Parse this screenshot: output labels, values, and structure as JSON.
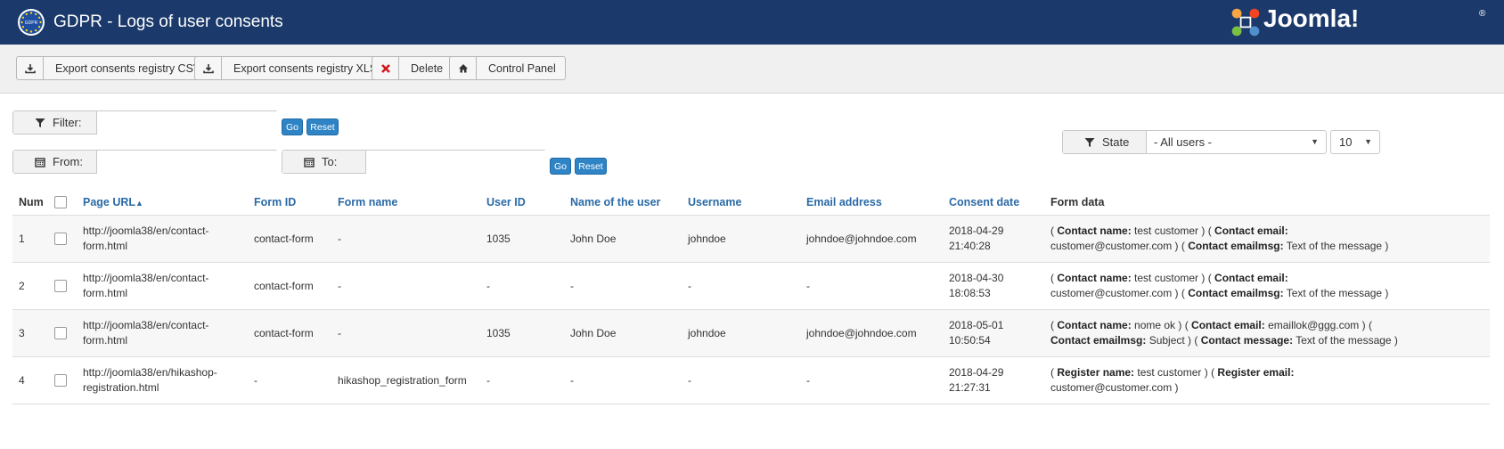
{
  "header": {
    "title": "GDPR - Logs of user consents",
    "badge_text": "GDPR",
    "brand": "Joomla!",
    "brand_mark": "®"
  },
  "toolbar": {
    "buttons": [
      {
        "label": "Export consents registry CSV",
        "icon": "download-icon"
      },
      {
        "label": "Export consents registry XLS",
        "icon": "download-icon"
      },
      {
        "label": "Delete",
        "icon": "close-icon"
      },
      {
        "label": "Control Panel",
        "icon": "home-icon"
      }
    ]
  },
  "filters": {
    "filter_label": "Filter:",
    "filter_value": "",
    "from_label": "From:",
    "to_label": "To:",
    "go_label": "Go",
    "reset_label": "Reset",
    "state_label": "State",
    "state_selected": "- All users -",
    "limit_selected": "10"
  },
  "table": {
    "headers": [
      "Num",
      "Page URL",
      "Form ID",
      "Form name",
      "User ID",
      "Name of the user",
      "Username",
      "Email address",
      "Consent date",
      "Form data"
    ],
    "sort_indicator": "▲",
    "rows": [
      {
        "num": "1",
        "url": [
          "http://joomla38/en/contact-",
          "form.html"
        ],
        "form_id": "contact-form",
        "form_name": "-",
        "user_id": "1035",
        "name": "John Doe",
        "username": "johndoe",
        "email": "johndoe@johndoe.com",
        "date": [
          "2018-04-29",
          "21:40:28"
        ],
        "form_data_lines": [
          [
            {
              "t": "( "
            },
            {
              "k": "Contact name:"
            },
            {
              "t": " test customer ) ( "
            },
            {
              "k": "Contact email:"
            }
          ],
          [
            {
              "t": "customer@customer.com ) ( "
            },
            {
              "k": "Contact emailmsg:"
            },
            {
              "t": " Text of the message )"
            }
          ]
        ]
      },
      {
        "num": "2",
        "url": [
          "http://joomla38/en/contact-",
          "form.html"
        ],
        "form_id": "contact-form",
        "form_name": "-",
        "user_id": "-",
        "name": "-",
        "username": "-",
        "email": "-",
        "date": [
          "2018-04-30",
          "18:08:53"
        ],
        "form_data_lines": [
          [
            {
              "t": "( "
            },
            {
              "k": "Contact name:"
            },
            {
              "t": " test customer ) ( "
            },
            {
              "k": "Contact email:"
            }
          ],
          [
            {
              "t": "customer@customer.com ) ( "
            },
            {
              "k": "Contact emailmsg:"
            },
            {
              "t": " Text of the message )"
            }
          ]
        ]
      },
      {
        "num": "3",
        "url": [
          "http://joomla38/en/contact-",
          "form.html"
        ],
        "form_id": "contact-form",
        "form_name": "-",
        "user_id": "1035",
        "name": "John Doe",
        "username": "johndoe",
        "email": "johndoe@johndoe.com",
        "date": [
          "2018-05-01",
          "10:50:54"
        ],
        "form_data_lines": [
          [
            {
              "t": "( "
            },
            {
              "k": "Contact name:"
            },
            {
              "t": " nome ok ) ( "
            },
            {
              "k": "Contact email:"
            },
            {
              "t": " emaillok@ggg.com ) ("
            }
          ],
          [
            {
              "k": "Contact emailmsg:"
            },
            {
              "t": " Subject ) ( "
            },
            {
              "k": "Contact message:"
            },
            {
              "t": " Text of the message )"
            }
          ]
        ]
      },
      {
        "num": "4",
        "url": [
          "http://joomla38/en/hikashop-",
          "registration.html"
        ],
        "form_id": "-",
        "form_name": "hikashop_registration_form",
        "user_id": "-",
        "name": "-",
        "username": "-",
        "email": "-",
        "date": [
          "2018-04-29",
          "21:27:31"
        ],
        "form_data_lines": [
          [
            {
              "t": "( "
            },
            {
              "k": "Register name:"
            },
            {
              "t": " test customer ) ( "
            },
            {
              "k": "Register email:"
            }
          ],
          [
            {
              "t": "customer@customer.com )"
            }
          ]
        ]
      }
    ]
  }
}
